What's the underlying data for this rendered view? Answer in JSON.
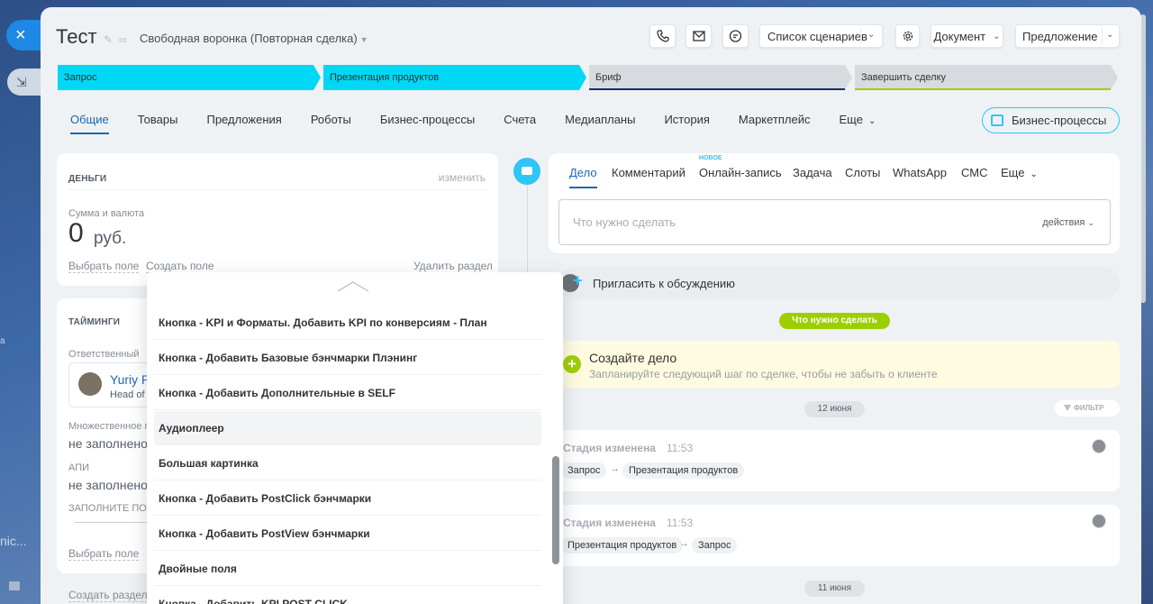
{
  "background": {
    "close_icon": "×",
    "minimize_icon": "⇲",
    "partial_text": "nic...",
    "partial_dot": "a"
  },
  "header": {
    "title": "Тест",
    "funnel": "Свободная воронка (Повторная сделка)",
    "scenario_label": "Список сценариев",
    "document_label": "Документ",
    "proposal_label": "Предложение"
  },
  "stages": [
    {
      "label": "Запрос",
      "state": "passed"
    },
    {
      "label": "Презентация продуктов",
      "state": "current"
    },
    {
      "label": "Бриф",
      "state": "upcoming",
      "line_color": "#1a2a6c"
    },
    {
      "label": "Завершить сделку",
      "state": "upcoming",
      "line_color": "#9dcf00"
    }
  ],
  "tabs": [
    "Общие",
    "Товары",
    "Предложения",
    "Роботы",
    "Бизнес-процессы",
    "Счета",
    "Медиапланы",
    "История",
    "Маркетплейс",
    "Еще"
  ],
  "bp_button": "Бизнес-процессы",
  "money": {
    "title": "ДЕНЬГИ",
    "edit": "изменить",
    "sum_label": "Сумма и валюта",
    "amount": "0",
    "currency": "руб.",
    "select_field": "Выбрать поле",
    "create_field": "Создать поле",
    "delete_section": "Удалить раздел"
  },
  "timings": {
    "title": "ТАЙМИНГИ",
    "responsible_label": "Ответственный",
    "user_name": "Yuriy Pa",
    "user_role": "Head of",
    "multi_label": "Множественное п",
    "not_filled_1": "не заполнено",
    "api_label": "АПИ",
    "not_filled_2": "не заполнено",
    "fill_label": "ЗАПОЛНИТЕ ПОЛ",
    "select_field": "Выбрать поле",
    "create_section": "Создать раздел"
  },
  "dropdown": {
    "items": [
      "Кнопка - KPI и Форматы. Добавить KPI по конверсиям - План",
      "Кнопка - Добавить Базовые бэнчмарки Плэнинг",
      "Кнопка - Добавить Дополнительные в SELF",
      "Аудиоплеер",
      "Большая картинка",
      "Кнопка - Добавить PostClick бэнчмарки",
      "Кнопка - Добавить PostView бэнчмарки",
      "Двойные поля",
      "Кнопка - Добавить KPI POST-CLICK"
    ]
  },
  "activity": {
    "tabs": [
      "Дело",
      "Комментарий",
      "Онлайн-запись",
      "Задача",
      "Слоты",
      "WhatsApp",
      "СМС",
      "Еще"
    ],
    "new_badge": "НОВОЕ",
    "placeholder": "Что нужно сделать",
    "actions": "действия"
  },
  "timeline": {
    "invite": "Пригласить к обсуждению",
    "todo_pill": "Что нужно сделать",
    "create_title": "Создайте дело",
    "create_sub": "Запланируйте следующий шаг по сделке, чтобы не забыть о клиенте",
    "date1": "12 июня",
    "filter": "ФИЛЬТР",
    "events": [
      {
        "title": "Стадия изменена",
        "time": "11:53",
        "from": "Запрос",
        "to": "Презентация продуктов"
      },
      {
        "title": "Стадия изменена",
        "time": "11:53",
        "from": "Презентация продуктов",
        "to": "Запрос"
      }
    ],
    "date2": "11 июня"
  }
}
